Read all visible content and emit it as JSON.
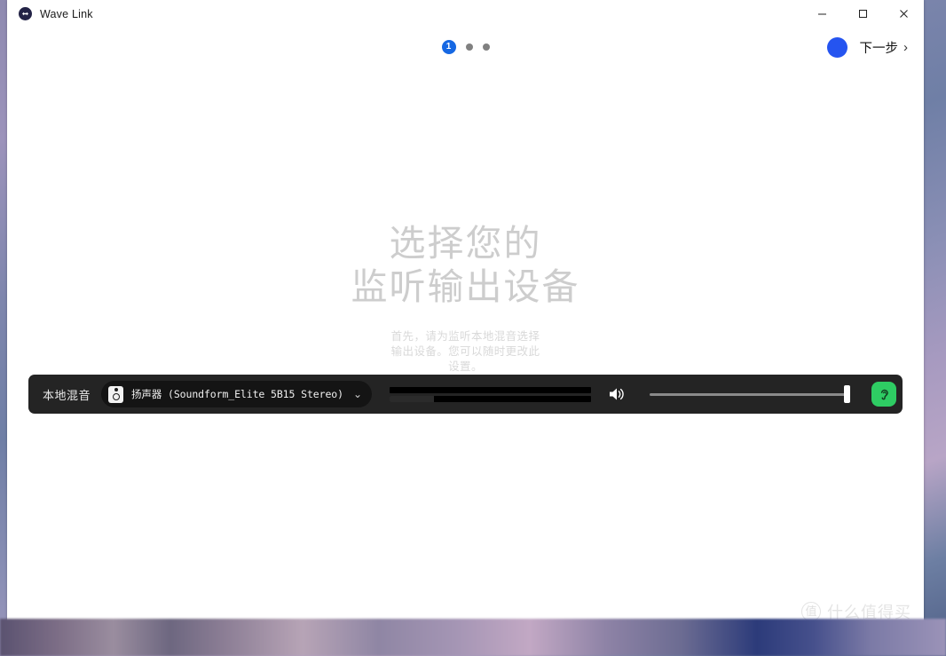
{
  "window": {
    "title": "Wave Link",
    "app_icon": "wave-link-icon",
    "controls": {
      "minimize": "minimize-icon",
      "maximize": "maximize-icon",
      "close": "close-icon"
    }
  },
  "wizard": {
    "steps": [
      {
        "label": "1",
        "active": true
      },
      {
        "label": "",
        "active": false
      },
      {
        "label": "",
        "active": false
      }
    ],
    "next_label": "下一步",
    "next_chevron": "chevron-right-icon",
    "accent_color": "#2554f0",
    "active_dot_color": "#1668e3"
  },
  "main": {
    "headline_line1": "选择您的",
    "headline_line2": "监听输出设备",
    "subtext": "首先，请为监听本地混音选择输出设备。您可以随时更改此设置。"
  },
  "channel_strip": {
    "label": "本地混音",
    "device": {
      "icon": "speaker-icon",
      "name": "扬声器 (Soundform_Elite 5B15 Stereo)",
      "chevron": "chevron-down-icon"
    },
    "meters": [
      {
        "name": "meter-left",
        "level_percent": 0
      },
      {
        "name": "meter-right",
        "level_percent": 22
      }
    ],
    "volume_icon": "volume-speaker-icon",
    "volume_percent": 100,
    "monitor_button": {
      "icon": "ear-icon",
      "active": true,
      "color": "#2ecc63"
    }
  },
  "watermark": {
    "badge": "值",
    "text": "什么值得买"
  }
}
